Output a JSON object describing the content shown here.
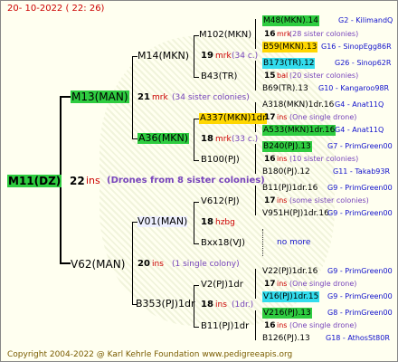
{
  "header": "20- 10-2022 ( 22: 26)",
  "footer": "Copyright 2004-2022 @ Karl Kehrle Foundation   www.pedigreeapis.org",
  "root": {
    "name": "M11(DZ)",
    "gen": "22",
    "note": "ins",
    "drones": "(Drones from 8 sister colonies)"
  },
  "g1": {
    "top": {
      "name": "M13(MAN)",
      "gen": "21",
      "note": "mrk",
      "extra": "(34 sister colonies)"
    },
    "bottom": {
      "name": "V62(MAN)",
      "gen": "20",
      "note": "ins",
      "extra": "(1 single colony)"
    }
  },
  "g2": {
    "m14": {
      "name": "M14(MKN)"
    },
    "a36": {
      "name": "A36(MKN)",
      "gen": "18",
      "note": "mrk",
      "extra": "(33 c.)"
    },
    "v01": {
      "name": "V01(MAN)",
      "gen": "18",
      "note": "hzbg"
    },
    "b353": {
      "name": "B353(PJ)1dr",
      "gen": "18",
      "note": "ins",
      "extra": "(1dr.)"
    }
  },
  "g3": {
    "m102": {
      "name": "M102(MKN)",
      "gen": "19",
      "note": "mrk",
      "extra": "(34 c.)"
    },
    "b43": {
      "name": "B43(TR)"
    },
    "a337": {
      "name": "A337(MKN)1dr"
    },
    "b100": {
      "name": "B100(PJ)"
    },
    "v612": {
      "name": "V612(PJ)",
      "gen": "17",
      "note": "ins",
      "extra": "(some sister colonies)"
    },
    "bxx18": {
      "name": "Bxx18(VJ)"
    },
    "v2": {
      "name": "V2(PJ)1dr"
    },
    "b11": {
      "name": "B11(PJ)1dr"
    }
  },
  "g4": [
    {
      "name": "M48(MKN).14",
      "code": "G2 - KilimandQ"
    },
    {
      "gen": "16",
      "note": "mrk",
      "extra": "(28 sister colonies)"
    },
    {
      "name": "B59(MKN).13",
      "code": "G16 - SinopEgg86R"
    },
    {
      "name": "B173(TR).12",
      "code": "G26 - Sinop62R"
    },
    {
      "gen": "15",
      "note": "bal",
      "extra": "(20 sister colonies)"
    },
    {
      "name": "B69(TR).13",
      "code": "G10 - Kangaroo98R"
    },
    {
      "name": "A318(MKN)1dr.16",
      "code": "G4 - Anat11Q"
    },
    {
      "gen": "17",
      "note": "ins",
      "extra": "(One single drone)"
    },
    {
      "name": "A533(MKN)1dr.16",
      "code": "G4 - Anat11Q"
    },
    {
      "name": "B240(PJ).13",
      "code": "G7 - PrimGreen00"
    },
    {
      "gen": "16",
      "note": "ins",
      "extra": "(10 sister colonies)"
    },
    {
      "name": "B180(PJ).12",
      "code": "G11 - Takab93R"
    },
    {
      "name": "B11(PJ)1dr.16",
      "code": "G9 - PrimGreen00"
    },
    {
      "name": "V951H(PJ)1dr.16",
      "code": "G9 - PrimGreen00"
    },
    {
      "name": "no more"
    },
    {
      "name": "V22(PJ)1dr.16",
      "code": "G9 - PrimGreen00"
    },
    {
      "name": "V16(PJ)1dr.15",
      "code": "G9 - PrimGreen00"
    },
    {
      "name": "V216(PJ).13",
      "code": "G8 - PrimGreen00"
    },
    {
      "name": "B126(PJ).13",
      "code": "G18 - AthosSt80R"
    }
  ]
}
